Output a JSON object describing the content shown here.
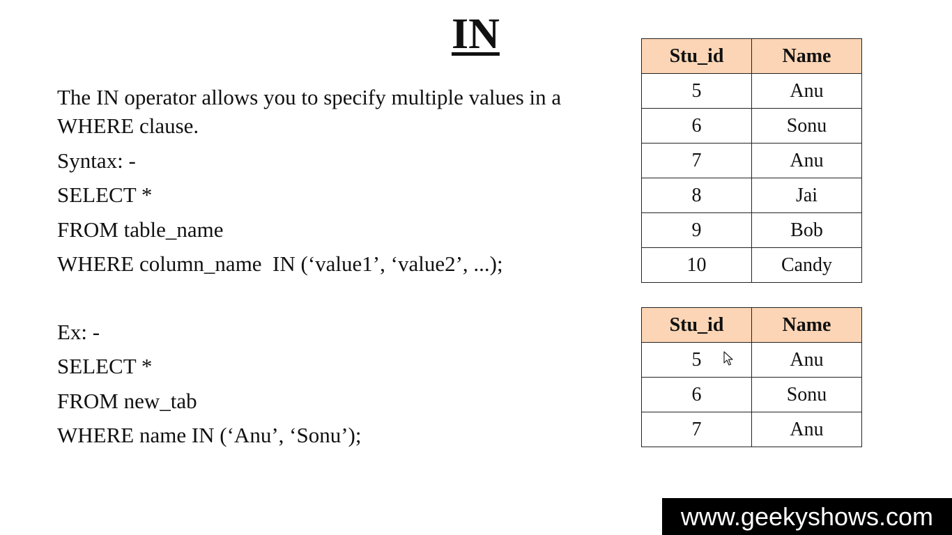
{
  "title": "IN",
  "description_line1": "The IN operator allows you to specify multiple values in a",
  "description_line2": "WHERE clause.",
  "syntax": {
    "label": "Syntax: -",
    "line1": "SELECT *",
    "line2": "FROM table_name",
    "line3": "WHERE column_name  IN (‘value1’, ‘value2’, ...);"
  },
  "example": {
    "label": "Ex: -",
    "line1": "SELECT *",
    "line2": "FROM new_tab",
    "line3": "WHERE name IN (‘Anu’, ‘Sonu’);"
  },
  "table1": {
    "headers": [
      "Stu_id",
      "Name"
    ],
    "rows": [
      [
        "5",
        "Anu"
      ],
      [
        "6",
        "Sonu"
      ],
      [
        "7",
        "Anu"
      ],
      [
        "8",
        "Jai"
      ],
      [
        "9",
        "Bob"
      ],
      [
        "10",
        "Candy"
      ]
    ]
  },
  "table2": {
    "headers": [
      "Stu_id",
      "Name"
    ],
    "rows": [
      [
        "5",
        "Anu"
      ],
      [
        "6",
        "Sonu"
      ],
      [
        "7",
        "Anu"
      ]
    ]
  },
  "watermark": "www.geekyshows.com",
  "colors": {
    "header_bg": "#fbd5b5",
    "watermark_bg": "#000000"
  },
  "icons": {
    "cursor": "mouse-pointer-icon"
  }
}
